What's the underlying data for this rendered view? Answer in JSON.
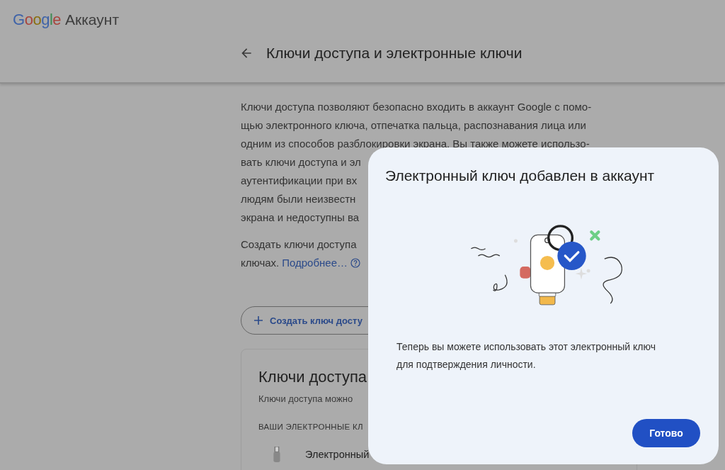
{
  "header": {
    "brand": [
      {
        "letter": "G",
        "color": "#3f63a8"
      },
      {
        "letter": "o",
        "color": "#a8453d"
      },
      {
        "letter": "o",
        "color": "#8a6f10"
      },
      {
        "letter": "g",
        "color": "#3f63a8"
      },
      {
        "letter": "l",
        "color": "#3d8a52"
      },
      {
        "letter": "e",
        "color": "#a8453d"
      }
    ],
    "product": "Аккаунт"
  },
  "page_title": "Ключи доступа и электронные ключи",
  "intro_lines": [
    "Ключи доступа позволяют безопасно входить в аккаунт Google с помо-",
    "щью электронного ключа, отпечатка пальца, распознавания лица или",
    "одним из способов разблокировки экрана. Вы также можете использо-",
    "вать ключи доступа и эл",
    "аутентификации при вх",
    "людям были неизвестн",
    "экрана и недоступны ва"
  ],
  "create_lines": [
    "Создать ключи доступа",
    "ключах."
  ],
  "learn_more": "Подробнее…",
  "create_button": "Создать ключ досту",
  "card": {
    "title": "Ключи доступа",
    "subtitle": "Ключи доступа можно",
    "section_label": "ВАШИ ЭЛЕКТРОННЫЕ КЛ",
    "item": "Электронный"
  },
  "dialog": {
    "title": "Электронный ключ добавлен в аккаунт",
    "body": "Теперь вы можете использовать этот электронный ключ для подтверждения личности.",
    "button": "Готово"
  }
}
